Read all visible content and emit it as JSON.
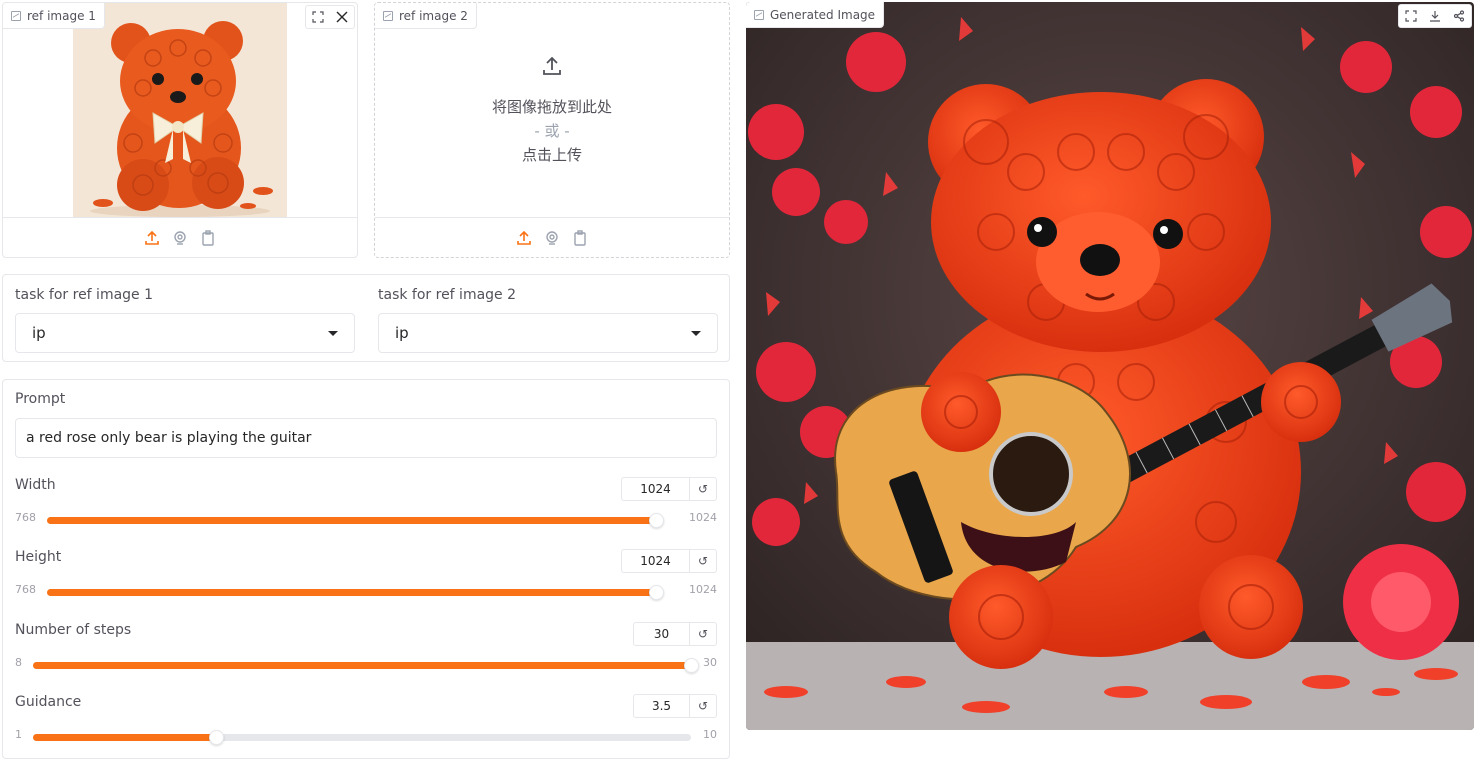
{
  "ref1": {
    "label": "ref image 1",
    "accent": "#f97316"
  },
  "ref2": {
    "label": "ref image 2",
    "drop_text": "将图像拖放到此处",
    "or_text": "- 或 -",
    "click_text": "点击上传"
  },
  "tasks": {
    "task1_label": "task for ref image 1",
    "task1_value": "ip",
    "task2_label": "task for ref image 2",
    "task2_value": "ip"
  },
  "prompt": {
    "label": "Prompt",
    "value": "a red rose only bear is playing the guitar"
  },
  "sliders": [
    {
      "label": "Width",
      "value": "1024",
      "min": "768",
      "max": "1024",
      "fraction": 1.0
    },
    {
      "label": "Height",
      "value": "1024",
      "min": "768",
      "max": "1024",
      "fraction": 1.0
    },
    {
      "label": "Number of steps",
      "value": "30",
      "min": "8",
      "max": "30",
      "fraction": 1.0
    },
    {
      "label": "Guidance",
      "value": "3.5",
      "min": "1",
      "max": "10",
      "fraction": 0.278
    }
  ],
  "output": {
    "label": "Generated Image"
  },
  "icons": {
    "upload": "upload-icon",
    "webcam": "webcam-icon",
    "clipboard": "clipboard-icon",
    "fullscreen": "fullscreen-icon",
    "close": "close-icon",
    "download": "download-icon",
    "share": "share-icon",
    "reset": "reset-icon"
  }
}
